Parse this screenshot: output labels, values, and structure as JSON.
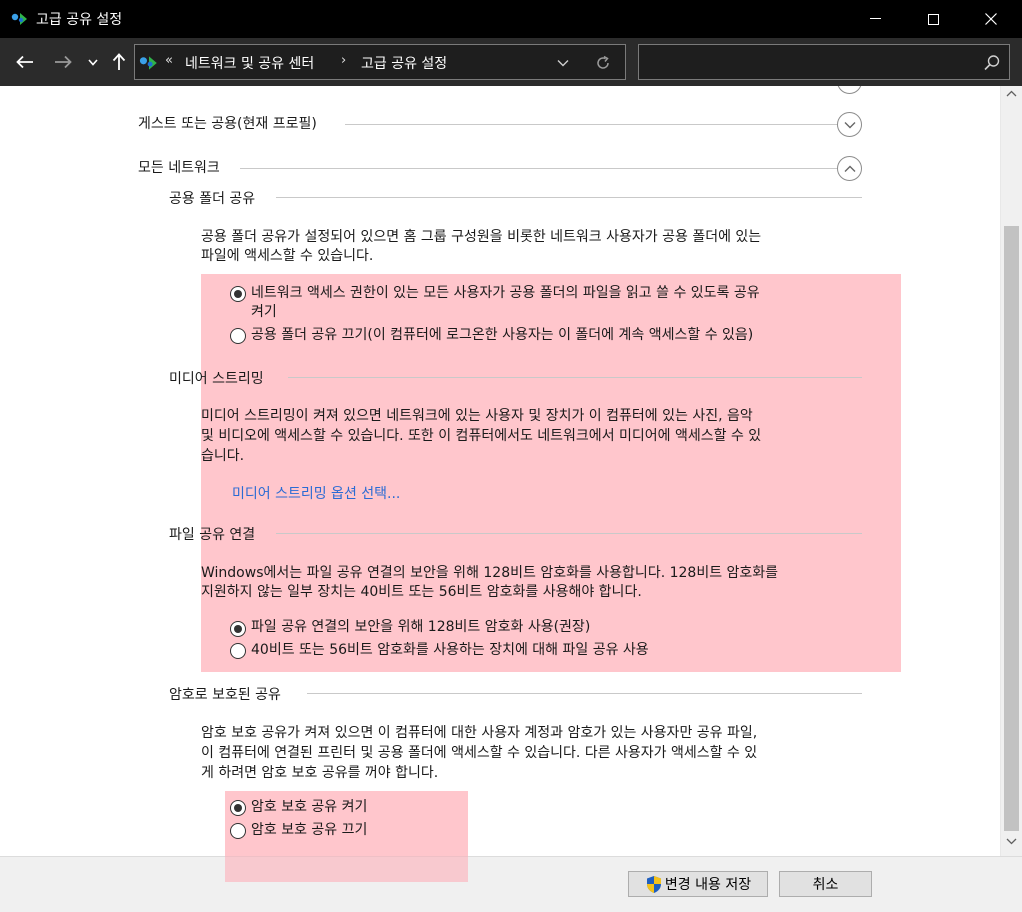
{
  "window": {
    "title": "고급 공유 설정"
  },
  "navigation": {
    "breadcrumb_overflow": "«",
    "breadcrumb_root": "네트워크 및 공유 센터",
    "breadcrumb_separator": "›",
    "breadcrumb_current": "고급 공유 설정",
    "search_placeholder": ""
  },
  "profiles": {
    "guest_public": "게스트 또는 공용(현재 프로필)",
    "all_networks": "모든 네트워크"
  },
  "public_folder_sharing": {
    "heading": "공용 폴더 공유",
    "description_line1": "공용 폴더 공유가 설정되어 있으면 홈 그룹 구성원을 비롯한 네트워크 사용자가 공용 폴더에 있는",
    "description_line2": "파일에 액세스할 수 있습니다.",
    "option_on_line1": "네트워크 액세스 권한이 있는 모든 사용자가 공용 폴더의 파일을 읽고 쓸 수 있도록 공유",
    "option_on_line2": "켜기",
    "option_off": "공용 폴더 공유 끄기(이 컴퓨터에 로그온한 사용자는 이 폴더에 계속 액세스할 수 있음)",
    "selected": "on"
  },
  "media_streaming": {
    "heading": "미디어 스트리밍",
    "description_line1": "미디어 스트리밍이 켜져 있으면 네트워크에 있는 사용자 및 장치가 이 컴퓨터에 있는 사진, 음악",
    "description_line2": "및 비디오에 액세스할 수 있습니다. 또한 이 컴퓨터에서도 네트워크에서 미디어에 액세스할 수 있",
    "description_line3": "습니다.",
    "options_link": "미디어 스트리밍 옵션 선택..."
  },
  "file_sharing_connections": {
    "heading": "파일 공유 연결",
    "description_line1": "Windows에서는 파일 공유 연결의 보안을 위해 128비트 암호화를 사용합니다. 128비트 암호화를",
    "description_line2": "지원하지 않는 일부 장치는 40비트 또는 56비트 암호화를 사용해야 합니다.",
    "option_128": "파일 공유 연결의 보안을 위해 128비트 암호화 사용(권장)",
    "option_40_56": "40비트 또는 56비트 암호화를 사용하는 장치에 대해 파일 공유 사용",
    "selected": "128"
  },
  "password_protected_sharing": {
    "heading": "암호로 보호된 공유",
    "description_line1": "암호 보호 공유가 켜져 있으면 이 컴퓨터에 대한 사용자 계정과 암호가 있는 사용자만 공유 파일,",
    "description_line2": "이 컴퓨터에 연결된 프린터 및 공용 폴더에 액세스할 수 있습니다. 다른 사용자가 액세스할 수 있",
    "description_line3": "게 하려면 암호 보호 공유를 꺼야 합니다.",
    "option_on": "암호 보호 공유 켜기",
    "option_off": "암호 보호 공유 끄기",
    "selected": "on"
  },
  "footer": {
    "save_label": "변경 내용 저장",
    "cancel_label": "취소"
  },
  "colors": {
    "titlebar": "#000000",
    "navbar": "#2b2b2b",
    "highlight": "#ffc6cc",
    "link": "#2a6bd4"
  }
}
